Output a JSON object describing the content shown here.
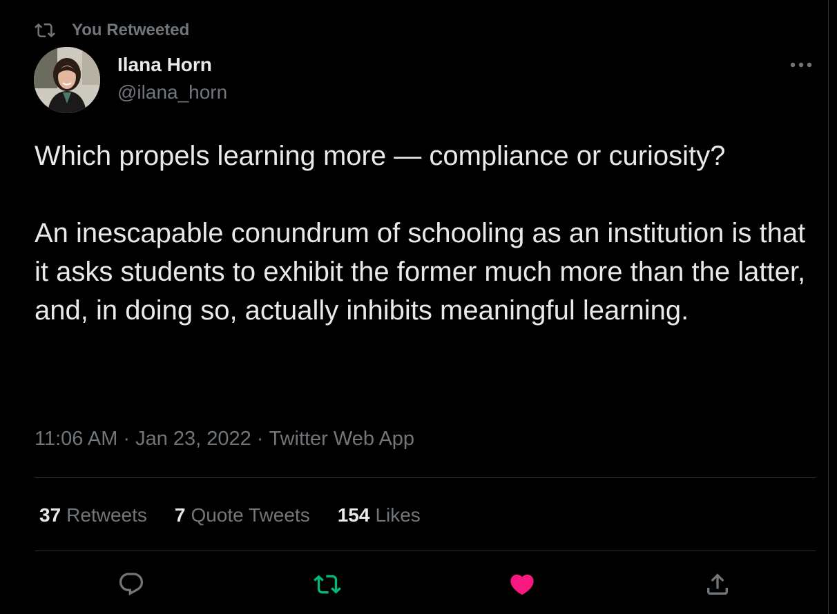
{
  "retweet_notice": {
    "label": "You Retweeted",
    "icon": "retweet-icon"
  },
  "author": {
    "name": "Ilana Horn",
    "handle": "@ilana_horn",
    "avatar": "avatar"
  },
  "more_icon": "more-options-icon",
  "tweet": {
    "paragraphs": [
      "Which propels learning more — compliance or curiosity?",
      "An inescapable conundrum of schooling as an institution is that it asks students to exhibit the former much more than the latter, and, in doing so, actually inhibits meaningful learning."
    ],
    "time": "11:06 AM",
    "date": "Jan 23, 2022",
    "source": "Twitter Web App",
    "separator": "·"
  },
  "stats": {
    "retweets": {
      "count": "37",
      "label": "Retweets"
    },
    "quotes": {
      "count": "7",
      "label": "Quote Tweets"
    },
    "likes": {
      "count": "154",
      "label": "Likes"
    }
  },
  "actions": {
    "reply_icon": "reply-icon",
    "retweet_icon": "retweet-icon",
    "like_icon": "heart-icon",
    "share_icon": "share-icon"
  },
  "colors": {
    "background": "#000000",
    "primary_text": "#e7e9ea",
    "secondary_text": "#71767b",
    "divider": "#2f3336",
    "retweet_active": "#00ba7c",
    "like_active": "#f91880"
  }
}
